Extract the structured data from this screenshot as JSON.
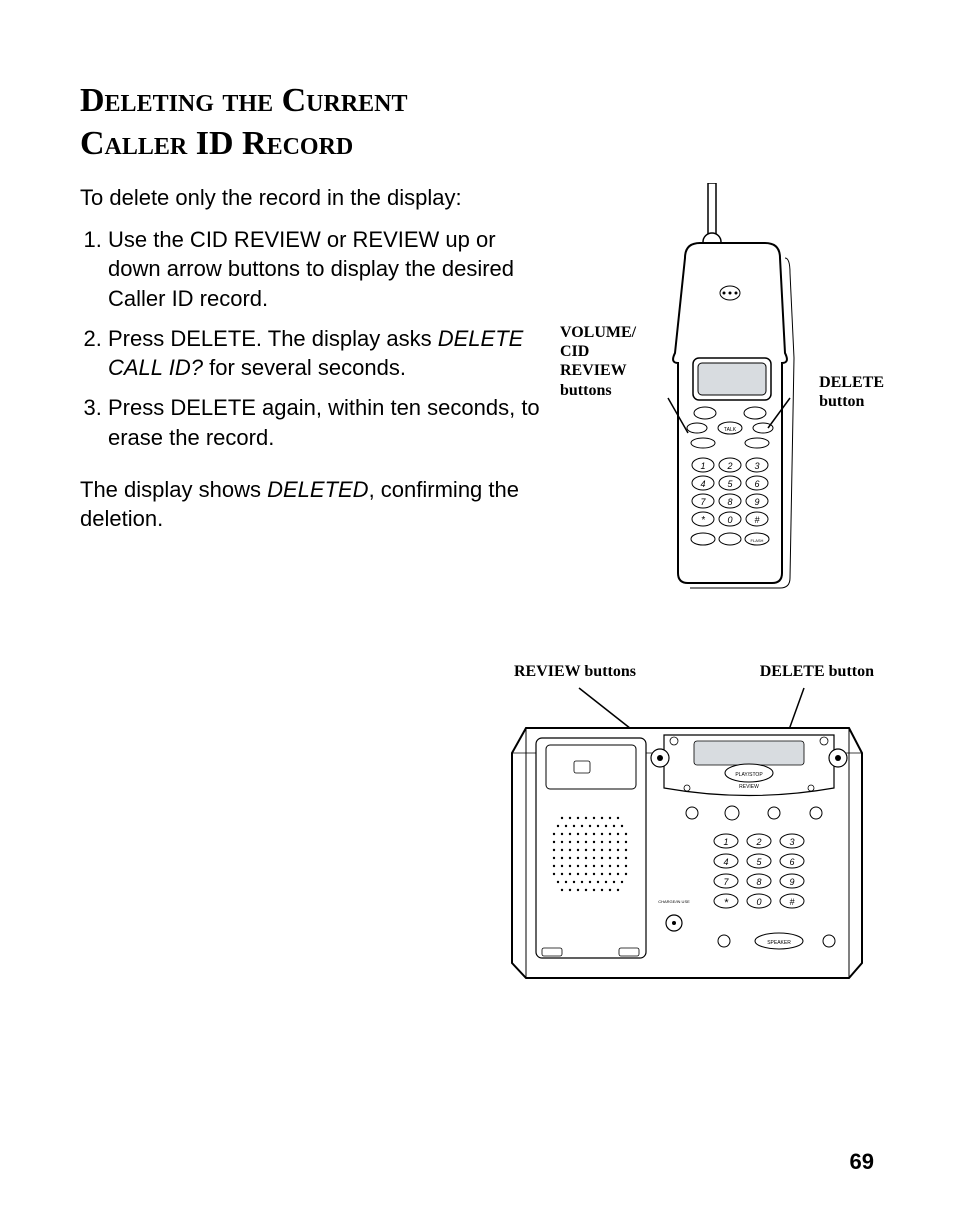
{
  "heading_line1": "Deleting the Current",
  "heading_line2": "Caller ID Record",
  "intro": "To delete only the record in the display:",
  "step1": "Use the CID REVIEW or REVIEW up or down arrow buttons to display the desired Caller ID record.",
  "step2_prefix": "Press DELETE. The display asks ",
  "step2_italic": "DELETE CALL ID?",
  "step2_suffix": " for several seconds.",
  "step3": "Press DELETE again, within ten seconds, to erase the record.",
  "closing_prefix": "The display shows ",
  "closing_italic": "DELETED",
  "closing_suffix": ", confirming the deletion.",
  "handset_label_left_l1": "VOLUME/",
  "handset_label_left_l2": "CID",
  "handset_label_left_l3": "REVIEW",
  "handset_label_left_l4": "buttons",
  "handset_label_right_l1": "DELETE",
  "handset_label_right_l2": "button",
  "base_label_left": "REVIEW buttons",
  "base_label_right": "DELETE button",
  "page_number": "69"
}
